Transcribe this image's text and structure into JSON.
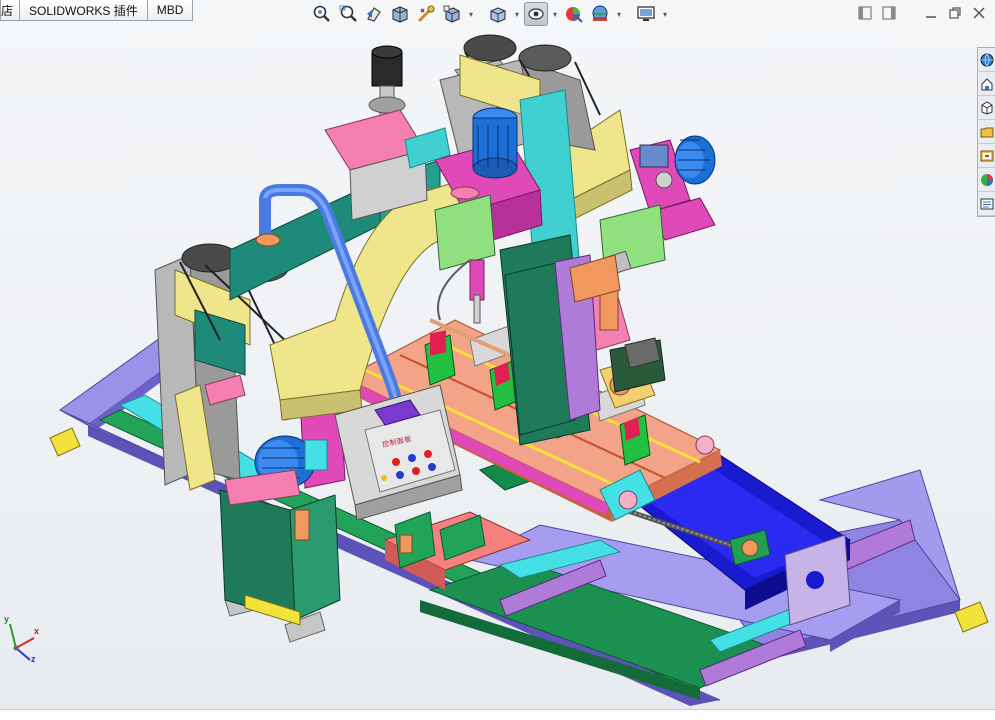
{
  "tabs": {
    "partial": "店",
    "items": [
      {
        "label": "SOLIDWORKS 插件"
      },
      {
        "label": "MBD"
      }
    ]
  },
  "hud_toolbar": {
    "buttons": [
      {
        "icon": "zoom-to-fit-icon"
      },
      {
        "icon": "zoom-to-area-icon"
      },
      {
        "icon": "previous-view-icon"
      },
      {
        "icon": "section-view-icon"
      },
      {
        "icon": "dynamic-annotation-views-icon"
      },
      {
        "icon": "view-orientation-icon",
        "dropdown": true
      },
      {
        "icon": "display-style-icon",
        "dropdown": true
      },
      {
        "icon": "hide-show-items-icon",
        "dropdown": true,
        "active": true
      },
      {
        "icon": "edit-appearance-icon"
      },
      {
        "icon": "apply-scene-icon",
        "dropdown": true
      },
      {
        "icon": "view-settings-icon",
        "dropdown": true
      }
    ]
  },
  "window_controls": {
    "buttons": [
      "tile-left-icon",
      "tile-right-icon",
      "minimize-icon",
      "restore-icon",
      "close-icon"
    ]
  },
  "task_pane": {
    "buttons": [
      "solidworks-resources-icon",
      "design-library-icon",
      "file-explorer-icon",
      "view-palette-icon",
      "appearances-scenes-icon",
      "custom-properties-icon",
      "forum-icon"
    ]
  },
  "model": {
    "control_panel_text": "控制面板"
  },
  "triad": {
    "x_label": "x",
    "y_label": "y",
    "z_label": "z"
  },
  "colors": {
    "frame_purple": "#8b7fe0",
    "base_green": "#1f9c52",
    "cyan": "#3ee0e0",
    "magenta": "#e04ab8",
    "pink": "#f57fb0",
    "yellow": "#efe68c",
    "teal": "#1d8a7a",
    "blue_motor": "#1c6fd6",
    "gray": "#b8b8b8",
    "orange": "#f0985e",
    "navy": "#1818c8"
  }
}
